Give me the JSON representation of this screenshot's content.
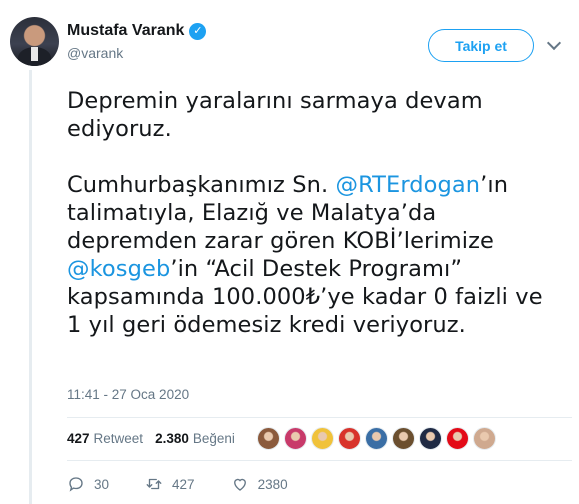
{
  "user": {
    "name": "Mustafa Varank",
    "handle": "@varank",
    "verified_glyph": "✓"
  },
  "follow_button_label": "Takip et",
  "tweet": {
    "line1": "Depremin yaralarını sarmaya devam",
    "line2": "ediyoruz.",
    "p2_prefix": "Cumhurbaşkanımız Sn. ",
    "mention1": "@RTErdogan",
    "p2_after_mention1": "’ın",
    "line4": "talimatıyla, Elazığ ve Malatya’da",
    "line5": "depremden zarar gören KOBİ’lerimize",
    "mention2": "@kosgeb",
    "line6_rest": "’in “Acil Destek Programı”",
    "line7": "kapsamında 100.000₺’ye kadar 0 faizli ve",
    "line8": "1 yıl geri ödemesiz kredi veriyoruz."
  },
  "timestamp": "11:41 - 27 Oca 2020",
  "stats": {
    "retweet_count": "427",
    "retweet_label": "Retweet",
    "like_count": "2.380",
    "like_label": "Beğeni"
  },
  "likers": [
    {
      "color": "#8b5a3c"
    },
    {
      "color": "#c83a6a"
    },
    {
      "color": "#f0c23a"
    },
    {
      "color": "#d8332b"
    },
    {
      "color": "#3a6ea5"
    },
    {
      "color": "#6b4f2f"
    },
    {
      "color": "#1f2a44"
    },
    {
      "color": "#e30a17"
    },
    {
      "color": "#cfa98f"
    }
  ],
  "actions": {
    "reply_count": "30",
    "retweet_count": "427",
    "like_count": "2380"
  },
  "colors": {
    "accent": "#1da1f2",
    "link": "#1b95e0",
    "muted": "#657786"
  },
  "icons": {
    "reply": "reply-icon",
    "retweet": "retweet-icon",
    "like": "heart-icon",
    "verified": "verified-badge-icon",
    "caret": "chevron-down-icon"
  }
}
